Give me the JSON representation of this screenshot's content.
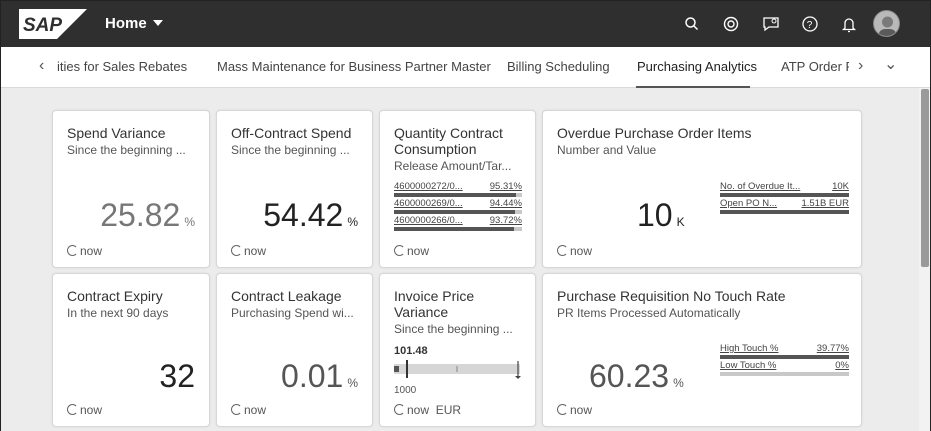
{
  "shell": {
    "logo_text": "SAP",
    "home_label": "Home",
    "icons": [
      "search-icon",
      "copilot-icon",
      "notification-bubble-icon",
      "help-icon",
      "bell-icon"
    ]
  },
  "tabs": {
    "items": [
      {
        "label": "ities for Sales Rebates",
        "active": false
      },
      {
        "label": "Mass Maintenance for Business Partner Master",
        "active": false
      },
      {
        "label": "Billing Scheduling",
        "active": false
      },
      {
        "label": "Purchasing Analytics",
        "active": true
      },
      {
        "label": "ATP Order F",
        "active": false
      }
    ],
    "left_arrow": "‹",
    "right_arrow": "›",
    "overflow": "⌄"
  },
  "tiles": {
    "spend_variance": {
      "title": "Spend Variance",
      "subtitle": "Since the beginning ...",
      "value": "25.82",
      "unit": "%",
      "footer": "now"
    },
    "off_contract": {
      "title": "Off-Contract Spend",
      "subtitle": "Since the beginning ...",
      "value": "54.42",
      "unit": "%",
      "footer": "now"
    },
    "qty_contract": {
      "title_line1": "Quantity Contract",
      "title_line2": "Consumption",
      "subtitle": "Release Amount/Tar...",
      "rows": [
        {
          "label": "4600000272/0...",
          "value": "95.31%",
          "fraction": 0.9531
        },
        {
          "label": "4600000269/0...",
          "value": "94.44%",
          "fraction": 0.9444
        },
        {
          "label": "4600000266/0...",
          "value": "93.72%",
          "fraction": 0.9372
        }
      ],
      "footer": "now"
    },
    "overdue_po": {
      "title": "Overdue Purchase Order Items",
      "subtitle": "Number and Value",
      "value": "10",
      "unit": "K",
      "rows": [
        {
          "label": "No. of Overdue It...",
          "value": "10K",
          "fraction": 1.0
        },
        {
          "label": "Open PO N...",
          "value": "1.51B EUR",
          "fraction": 1.0
        }
      ],
      "footer": "now"
    },
    "contract_expiry": {
      "title": "Contract Expiry",
      "subtitle": "In the next 90 days",
      "value": "32",
      "unit": "",
      "footer": "now"
    },
    "contract_leakage": {
      "title": "Contract Leakage",
      "subtitle": "Purchasing Spend wi...",
      "value": "0.01",
      "unit": "%",
      "footer": "now"
    },
    "invoice_variance": {
      "title_line1": "Invoice Price",
      "title_line2": "Variance",
      "subtitle": "Since the beginning ...",
      "top_value": "101.48",
      "bottom_value": "1000",
      "footer": "now",
      "footer_unit": "EUR"
    },
    "pr_no_touch": {
      "title": "Purchase Requisition No Touch Rate",
      "subtitle": "PR Items Processed Automatically",
      "value": "60.23",
      "unit": "%",
      "rows": [
        {
          "label": "High Touch %",
          "value": "39.77%",
          "fraction": 1.0
        },
        {
          "label": "Low Touch %",
          "value": "0%",
          "fraction": 0.0
        }
      ],
      "footer": "now"
    }
  }
}
